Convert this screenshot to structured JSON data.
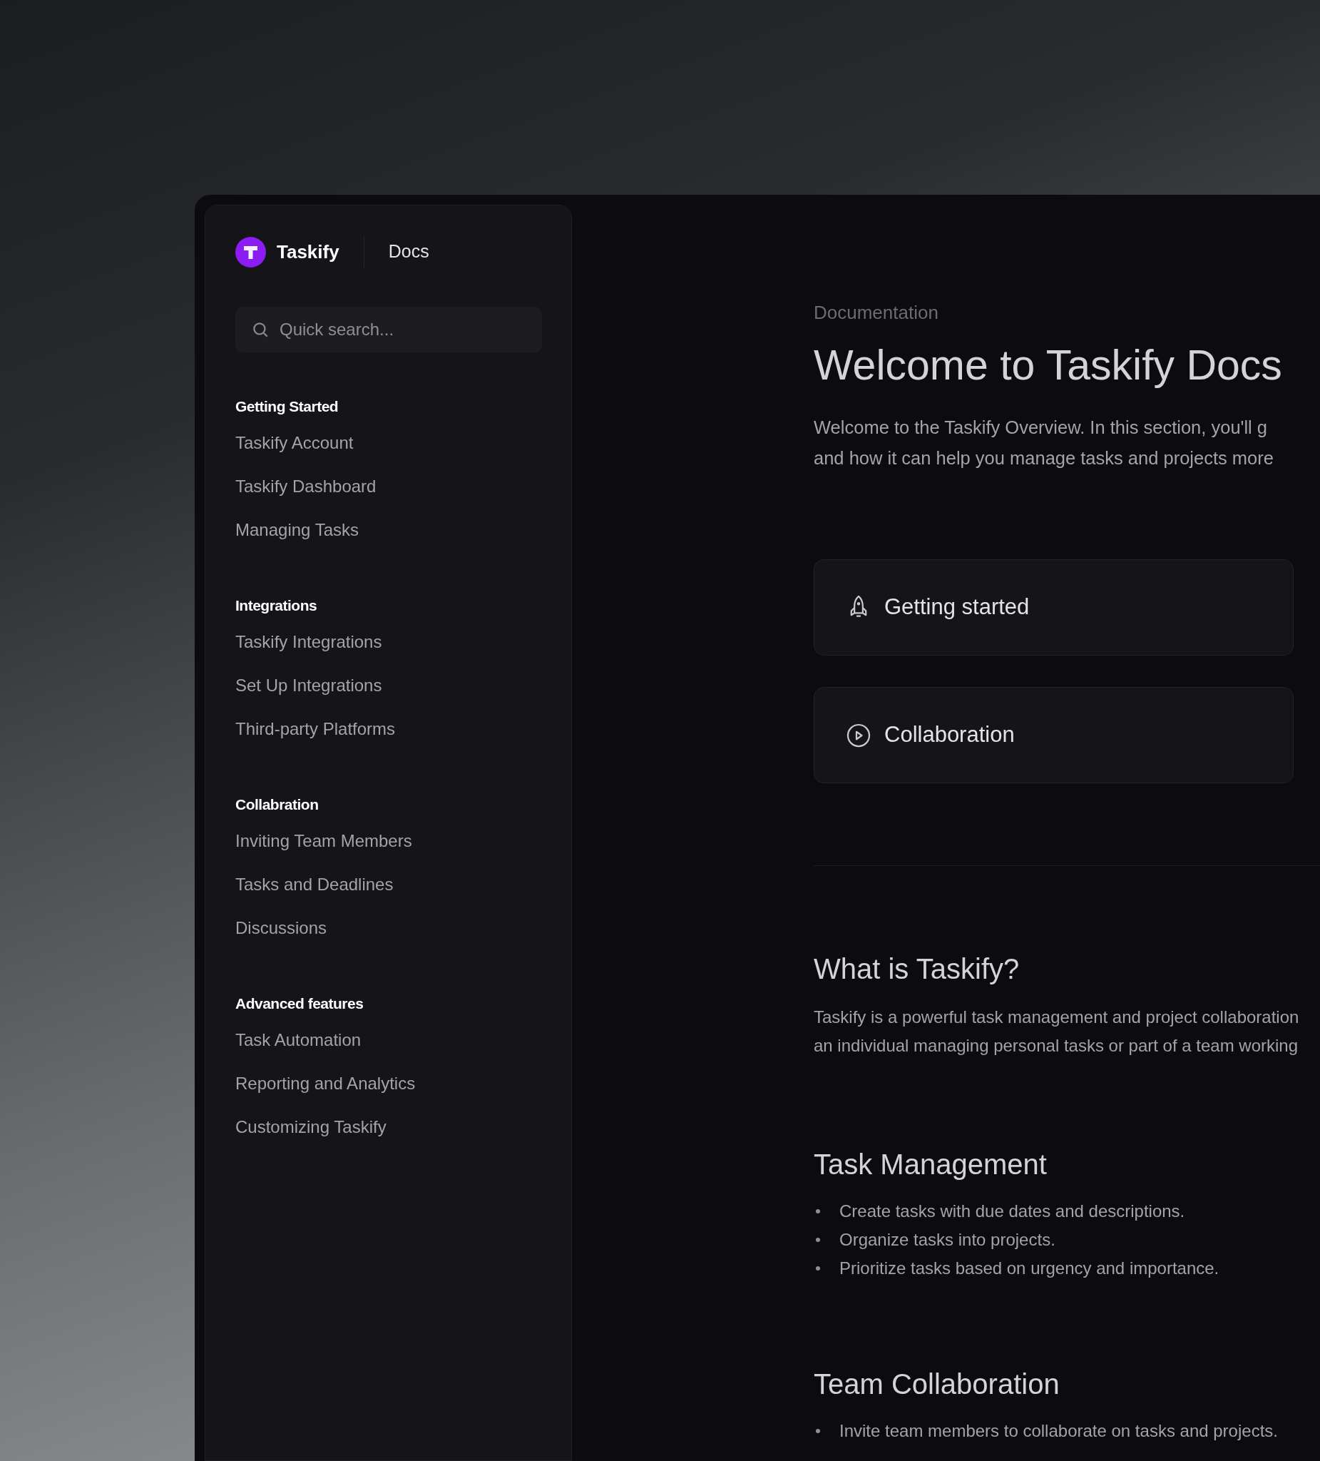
{
  "brand": {
    "name": "Taskify",
    "section": "Docs"
  },
  "search": {
    "placeholder": "Quick search..."
  },
  "nav": [
    {
      "title": "Getting Started",
      "items": [
        "Taskify Account",
        "Taskify Dashboard",
        "Managing Tasks"
      ]
    },
    {
      "title": "Integrations",
      "items": [
        "Taskify Integrations",
        "Set Up Integrations",
        "Third-party Platforms"
      ]
    },
    {
      "title": "Collabration",
      "items": [
        "Inviting Team Members",
        "Tasks and Deadlines",
        "Discussions"
      ]
    },
    {
      "title": "Advanced features",
      "items": [
        "Task Automation",
        "Reporting and Analytics",
        "Customizing Taskify"
      ]
    }
  ],
  "content": {
    "eyebrow": "Documentation",
    "title": "Welcome to Taskify Docs",
    "intro": [
      "Welcome to the Taskify Overview. In this section, you'll g",
      "and how it can help you manage tasks and projects more"
    ],
    "cards": [
      {
        "kind": "rocket",
        "label": "Getting started"
      },
      {
        "kind": "play",
        "label": "Collaboration"
      }
    ],
    "sections": [
      {
        "heading": "What is Taskify?",
        "lines": [
          "Taskify is a powerful task management and project collaboration",
          "an individual managing personal tasks or part of a team working"
        ]
      },
      {
        "heading": "Task Management",
        "bullets": [
          "Create tasks with due dates and descriptions.",
          "Organize tasks into projects.",
          "Prioritize tasks based on urgency and importance."
        ]
      },
      {
        "heading": "Team Collaboration",
        "bullets": [
          "Invite team members to collaborate on tasks and projects."
        ]
      }
    ]
  }
}
